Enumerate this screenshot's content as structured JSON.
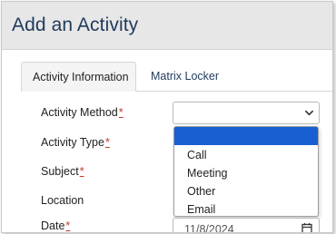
{
  "dialog": {
    "title": "Add an Activity"
  },
  "tabs": [
    {
      "label": "Activity Information",
      "active": true
    },
    {
      "label": "Matrix Locker",
      "active": false
    }
  ],
  "fields": {
    "activity_method": {
      "label": "Activity Method",
      "required_mark": "*",
      "value": ""
    },
    "activity_type": {
      "label": "Activity Type",
      "required_mark": "*"
    },
    "subject": {
      "label": "Subject",
      "required_mark": "*"
    },
    "location": {
      "label": "Location"
    },
    "date": {
      "label": "Date",
      "required_mark": "*",
      "value": "11/8/2024"
    }
  },
  "dropdown": {
    "options": [
      "",
      "Call",
      "Meeting",
      "Other",
      "Email"
    ],
    "highlighted_index": 0
  },
  "colors": {
    "header_bg": "#e7e7e7",
    "title": "#1f3b5c",
    "required": "#c0392b",
    "highlight": "#1a5fd1"
  },
  "icons": {
    "select": "chevron-down-icon",
    "date": "calendar-icon"
  }
}
